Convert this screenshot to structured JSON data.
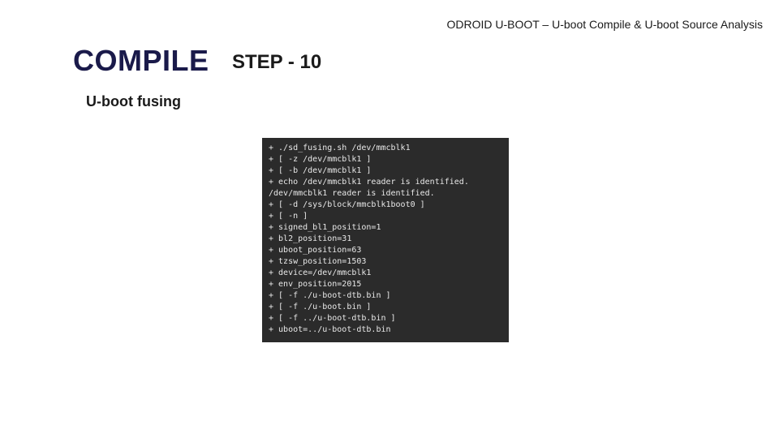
{
  "header": "ODROID U-BOOT – U-boot Compile & U-boot Source Analysis",
  "title": {
    "big": "COMPILE",
    "step": "STEP - 10"
  },
  "subtitle": "U-boot fusing",
  "terminal": {
    "lines": [
      "+ ./sd_fusing.sh /dev/mmcblk1",
      "+ [ -z /dev/mmcblk1 ]",
      "+ [ -b /dev/mmcblk1 ]",
      "+ echo /dev/mmcblk1 reader is identified.",
      "/dev/mmcblk1 reader is identified.",
      "+ [ -d /sys/block/mmcblk1boot0 ]",
      "+ [ -n ]",
      "+ signed_bl1_position=1",
      "+ bl2_position=31",
      "+ uboot_position=63",
      "+ tzsw_position=1503",
      "+ device=/dev/mmcblk1",
      "+ env_position=2015",
      "+ [ -f ./u-boot-dtb.bin ]",
      "+ [ -f ./u-boot.bin ]",
      "+ [ -f ../u-boot-dtb.bin ]",
      "+ uboot=../u-boot-dtb.bin"
    ]
  }
}
